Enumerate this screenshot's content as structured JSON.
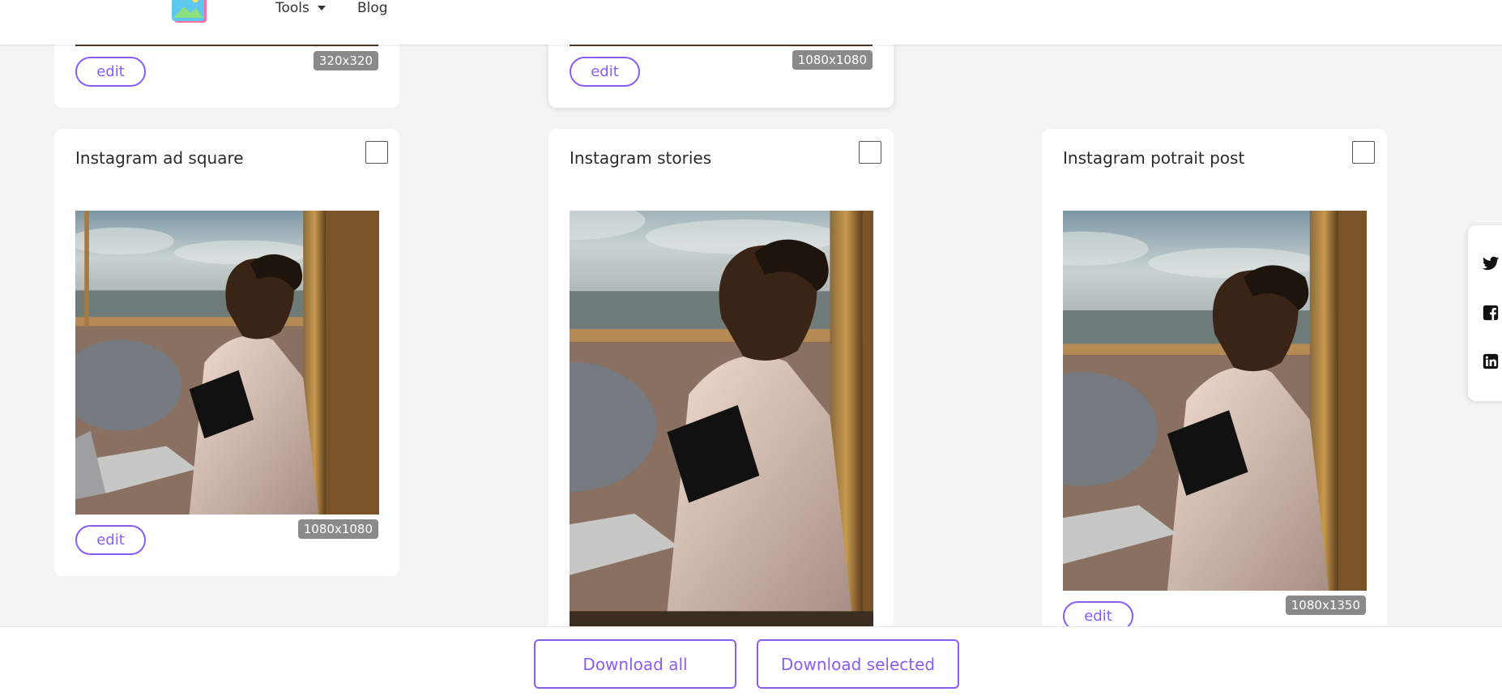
{
  "nav": {
    "tools_label": "Tools",
    "blog_label": "Blog"
  },
  "colors": {
    "accent": "#8b5cf6",
    "badge_bg": "#8a8a8a",
    "page_bg": "#f4f4f4"
  },
  "top_cards": [
    {
      "edit_label": "edit",
      "size": "320x320"
    },
    {
      "edit_label": "edit",
      "size": "1080x1080"
    }
  ],
  "cards": [
    {
      "title": "Instagram ad square",
      "edit_label": "edit",
      "size": "1080x1080"
    },
    {
      "title": "Instagram stories",
      "edit_label": "edit",
      "size": ""
    },
    {
      "title": "Instagram potrait post",
      "edit_label": "edit",
      "size": "1080x1350"
    }
  ],
  "bottom": {
    "download_all": "Download all",
    "download_selected": "Download selected"
  },
  "share": {
    "icons": [
      "twitter-icon",
      "facebook-icon",
      "linkedin-icon"
    ]
  }
}
